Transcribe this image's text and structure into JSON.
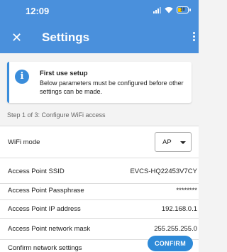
{
  "status_bar": {
    "time": "12:09",
    "battery": "10"
  },
  "app_bar": {
    "title": "Settings",
    "bg_color": "#4a90dc"
  },
  "info_card": {
    "title": "First use setup",
    "body": "Below parameters must be configured before other settings can be made.",
    "accent_color": "#3a8ddb"
  },
  "step_label": "Step 1 of 3: Configure WiFi access",
  "settings": {
    "wifi_mode": {
      "label": "WiFi mode",
      "value": "AP"
    },
    "ssid": {
      "label": "Access Point SSID",
      "value": "EVCS-HQ22453V7CY"
    },
    "passphrase": {
      "label": "Access Point Passphrase",
      "value": "********"
    },
    "ip": {
      "label": "Access Point IP address",
      "value": "192.168.0.1"
    },
    "mask": {
      "label": "Access Point network mask",
      "value": "255.255.255.0"
    },
    "confirm": {
      "label": "Confirm network settings",
      "button": "CONFIRM"
    }
  }
}
